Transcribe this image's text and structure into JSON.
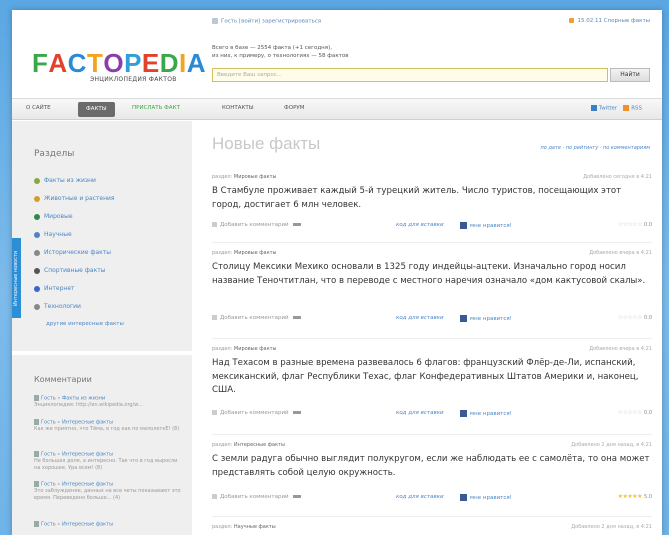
{
  "header": {
    "logo_letters": [
      {
        "ch": "F",
        "color": "#3aa84a"
      },
      {
        "ch": "A",
        "color": "#e0422b"
      },
      {
        "ch": "C",
        "color": "#2a8ad4"
      },
      {
        "ch": "T",
        "color": "#f3a320"
      },
      {
        "ch": "O",
        "color": "#8b3ea8"
      },
      {
        "ch": "P",
        "color": "#2f9fd9"
      },
      {
        "ch": "E",
        "color": "#e0422b"
      },
      {
        "ch": "D",
        "color": "#3aa84a"
      },
      {
        "ch": "I",
        "color": "#f3a320"
      },
      {
        "ch": "A",
        "color": "#2a8ad4"
      }
    ],
    "logo_subtitle": "ЭНЦИКЛОПЕДИЯ ФАКТОВ",
    "userbar": "Гость [войти] зарегистрироваться",
    "date": "15.02.11 Спорные факты",
    "stats_line1": "Всего в базе — 2554 факта (+1 сегодня),",
    "stats_line2": "из них, к примеру, о технологиях — 58 фактов",
    "search_placeholder": "Введите Ваш запрос...",
    "search_button": "Найти"
  },
  "nav": {
    "items": [
      "О сайте",
      "Факты",
      "Прислать факт",
      "Контакты",
      "Форум"
    ],
    "twitter": "Twitter",
    "rss": "RSS"
  },
  "sidebar": {
    "sections_title": "Разделы",
    "items": [
      {
        "label": "Факты из жизни",
        "icon": "lifebuoy-icon",
        "color": "#8aa93b"
      },
      {
        "label": "Животные и растения",
        "icon": "leaf-icon",
        "color": "#d89b2b"
      },
      {
        "label": "Мировые",
        "icon": "globe-icon",
        "color": "#2e8a4a"
      },
      {
        "label": "Научные",
        "icon": "flask-icon",
        "color": "#4a86c5"
      },
      {
        "label": "Исторические факты",
        "icon": "scroll-icon",
        "color": "#888888"
      },
      {
        "label": "Спортивные факты",
        "icon": "ball-icon",
        "color": "#555555"
      },
      {
        "label": "Интернет",
        "icon": "monitor-icon",
        "color": "#3a67c8"
      },
      {
        "label": "Технологии",
        "icon": "gear-icon",
        "color": "#888888"
      }
    ],
    "more_link": "другие интересные факты",
    "vertical_tab": "Интересные новости",
    "comments_title": "Комментарии",
    "comments": [
      {
        "who": "Гость",
        "section": "Факты из жизни",
        "text": "Энциклопедия: http://en.wikipedia.org/w..."
      },
      {
        "who": "Гость",
        "section": "Интересные факты",
        "text": "Как же приятно, что Тёма, в год как по малолеткЕ! (8)"
      },
      {
        "who": "Гость",
        "section": "Интересные факты",
        "text": "Не большая доля, а интересно. Так что в год выросли на хорошее. Ура всем! (8)"
      },
      {
        "who": "Гость",
        "section": "Интересные факты",
        "text": "Это заблуждение, данных на все четы показывают это время. Переведено больше... (4)"
      },
      {
        "who": "Гость",
        "section": "Интересные факты",
        "text": ""
      }
    ]
  },
  "main": {
    "title": "Новые факты",
    "sort": "по дате · по рейтингу · по комментариям",
    "facts": [
      {
        "section_label": "раздел:",
        "section": "Мировые факты",
        "meta": "Добавлено сегодня в 4:21",
        "text": "В Стамбуле проживает каждый 5-й турецкий житель. Число туристов, посещающих этот город, достигает 6 млн человек.",
        "comment": "Добавить комментарий",
        "insert": "код для вставки",
        "like": "мне нравится!",
        "stars": "☆☆☆☆☆",
        "score": "0.0",
        "gold": false
      },
      {
        "section_label": "раздел:",
        "section": "Мировые факты",
        "meta": "Добавлено вчера в 4:21",
        "text": "Столицу Мексики Мехико основали в 1325 году индейцы-ацтеки. Изначально город носил название Теночтитлан, что в переводе с местного наречия означало «дом кактусовой скалы».",
        "comment": "Добавить комментарий",
        "insert": "код для вставки",
        "like": "мне нравится!",
        "stars": "☆☆☆☆☆",
        "score": "0.0",
        "gold": false
      },
      {
        "section_label": "раздел:",
        "section": "Мировые факты",
        "meta": "Добавлено вчера в 4:21",
        "text": "Над Техасом в разные времена развевалось 6 флагов: французский Флёр-де-Ли, испанский, мексиканский, флаг Республики Техас, флаг Конфедеративных Штатов Америки и, наконец, США.",
        "comment": "Добавить комментарий",
        "insert": "код для вставки",
        "like": "мне нравится!",
        "stars": "☆☆☆☆☆",
        "score": "0.0",
        "gold": false
      },
      {
        "section_label": "раздел:",
        "section": "Интересные факты",
        "meta": "Добавлено 2 дня назад, в 4:21",
        "text": "С земли радуга обычно выглядит полукругом, если же наблюдать ее с самолёта, то она может представлять собой целую окружность.",
        "comment": "Добавить комментарий",
        "insert": "код для вставки",
        "like": "мне нравится!",
        "stars": "★★★★★",
        "score": "5.0",
        "gold": true
      },
      {
        "section_label": "раздел:",
        "section": "Научные факты",
        "meta": "Добавлено 2 дня назад, в 4:21",
        "text": "",
        "comment": "",
        "insert": "",
        "like": "",
        "stars": "",
        "score": "",
        "gold": false
      }
    ]
  }
}
